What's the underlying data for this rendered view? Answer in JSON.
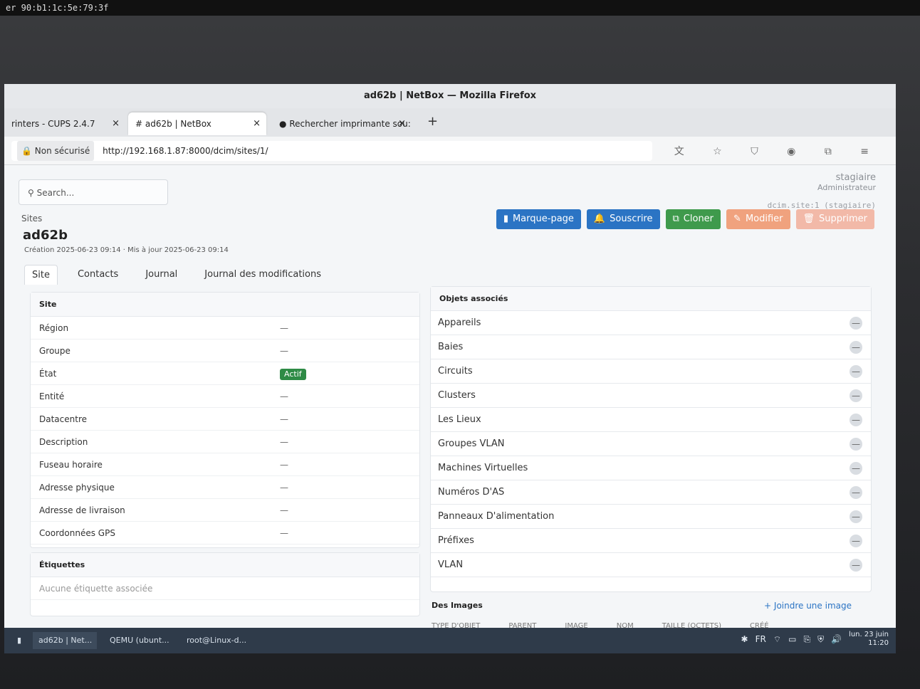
{
  "top_strip_text": "er 90:b1:1c:5e:79:3f",
  "window": {
    "title": "ad62b | NetBox — Mozilla Firefox"
  },
  "browser_tabs": [
    {
      "label": "rinters - CUPS 2.4.7",
      "close": "×"
    },
    {
      "label": "ad62b | NetBox",
      "close": "×",
      "active": true
    },
    {
      "label": "Rechercher imprimante sou:",
      "close": "×"
    }
  ],
  "new_tab": "+",
  "url": {
    "security": "Non sécurisé",
    "value": "http://192.168.1.87:8000/dcim/sites/1/"
  },
  "user": {
    "name": "stagiaire",
    "role": "Administrateur"
  },
  "object_id": "dcim.site:1 (stagiaire)",
  "search": {
    "placeholder": "Search..."
  },
  "breadcrumb": "Sites",
  "site": {
    "name": "ad62b",
    "meta": "Création 2025-06-23 09:14 · Mis à jour 2025-06-23 09:14"
  },
  "actions": {
    "bookmark": "Marque-page",
    "subscribe": "Souscrire",
    "clone": "Cloner",
    "edit": "Modifier",
    "delete": "Supprimer"
  },
  "tabs": [
    "Site",
    "Contacts",
    "Journal",
    "Journal des modifications"
  ],
  "site_card": {
    "title": "Site",
    "rows": [
      {
        "label": "Région",
        "value": "—"
      },
      {
        "label": "Groupe",
        "value": "—"
      },
      {
        "label": "État",
        "value": "Actif"
      },
      {
        "label": "Entité",
        "value": "—"
      },
      {
        "label": "Datacentre",
        "value": "—"
      },
      {
        "label": "Description",
        "value": "—"
      },
      {
        "label": "Fuseau horaire",
        "value": "—"
      },
      {
        "label": "Adresse physique",
        "value": "—"
      },
      {
        "label": "Adresse de livraison",
        "value": "—"
      },
      {
        "label": "Coordonnées GPS",
        "value": "—"
      }
    ]
  },
  "tags_card": {
    "title": "Étiquettes",
    "empty": "Aucune étiquette associée"
  },
  "related": {
    "title": "Objets associés",
    "items": [
      {
        "label": "Appareils",
        "count": "—"
      },
      {
        "label": "Baies",
        "count": "—"
      },
      {
        "label": "Circuits",
        "count": "—"
      },
      {
        "label": "Clusters",
        "count": "—"
      },
      {
        "label": "Les Lieux",
        "count": "—"
      },
      {
        "label": "Groupes VLAN",
        "count": "—"
      },
      {
        "label": "Machines Virtuelles",
        "count": "—"
      },
      {
        "label": "Numéros D'AS",
        "count": "—"
      },
      {
        "label": "Panneaux D'alimentation",
        "count": "—"
      },
      {
        "label": "Préfixes",
        "count": "—"
      },
      {
        "label": "VLAN",
        "count": "—"
      }
    ]
  },
  "images": {
    "title": "Des Images",
    "join": "+ Joindre une image",
    "columns": [
      "TYPE D'OBJET",
      "PARENT",
      "IMAGE",
      "NOM",
      "TAILLE (OCTETS)",
      "CRÉÉ"
    ]
  },
  "taskbar": {
    "items": [
      "ad62b | Net...",
      "QEMU (ubunt...",
      "root@Linux-d..."
    ],
    "lang": "FR",
    "clock_date": "lun. 23 juin",
    "clock_time": "11:20"
  }
}
